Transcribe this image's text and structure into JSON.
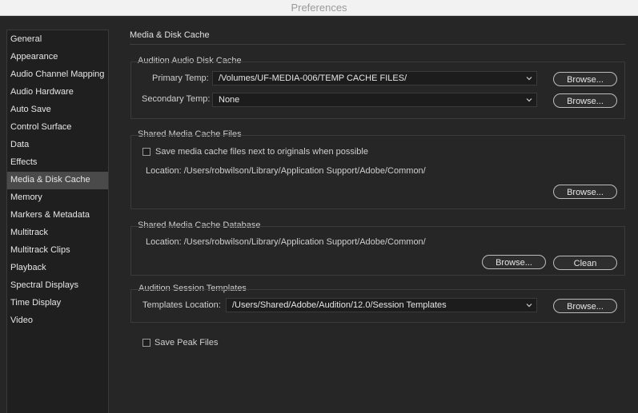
{
  "window": {
    "title": "Preferences"
  },
  "sidebar": {
    "items": [
      {
        "label": "General"
      },
      {
        "label": "Appearance"
      },
      {
        "label": "Audio Channel Mapping"
      },
      {
        "label": "Audio Hardware"
      },
      {
        "label": "Auto Save"
      },
      {
        "label": "Control Surface"
      },
      {
        "label": "Data"
      },
      {
        "label": "Effects"
      },
      {
        "label": "Media & Disk Cache"
      },
      {
        "label": "Memory"
      },
      {
        "label": "Markers & Metadata"
      },
      {
        "label": "Multitrack"
      },
      {
        "label": "Multitrack Clips"
      },
      {
        "label": "Playback"
      },
      {
        "label": "Spectral Displays"
      },
      {
        "label": "Time Display"
      },
      {
        "label": "Video"
      }
    ],
    "selected": "Media & Disk Cache"
  },
  "main": {
    "heading": "Media & Disk Cache",
    "disk_cache": {
      "title": "Audition Audio Disk Cache",
      "primary_label": "Primary Temp:",
      "primary_value": "/Volumes/UF-MEDIA-006/TEMP CACHE FILES/",
      "secondary_label": "Secondary Temp:",
      "secondary_value": "None",
      "browse_label": "Browse..."
    },
    "shared_files": {
      "title": "Shared Media Cache Files",
      "checkbox_label": "Save media cache files next to originals when possible",
      "checkbox_checked": false,
      "location": "Location: /Users/robwilson/Library/Application Support/Adobe/Common/",
      "browse_label": "Browse..."
    },
    "shared_db": {
      "title": "Shared Media Cache Database",
      "location": "Location: /Users/robwilson/Library/Application Support/Adobe/Common/",
      "browse_label": "Browse...",
      "clean_label": "Clean"
    },
    "templates": {
      "title": "Audition Session Templates",
      "location_label": "Templates Location:",
      "location_value": "/Users/Shared/Adobe/Audition/12.0/Session Templates",
      "browse_label": "Browse..."
    },
    "save_peak": {
      "label": "Save Peak Files",
      "checked": false
    }
  },
  "colors": {
    "background": "#262626",
    "sidebar_bg": "#1f1f1f",
    "selected_bg": "#4a4a4a",
    "text": "#e6e6e6"
  }
}
